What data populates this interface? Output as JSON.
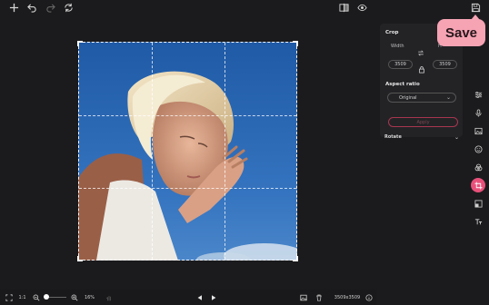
{
  "crop_panel": {
    "title": "Crop",
    "width_label": "Width",
    "height_label": "H",
    "width_value": "3509",
    "height_value": "3509",
    "aspect_ratio_label": "Aspect ratio",
    "aspect_ratio_value": "Original",
    "apply_label": "Apply"
  },
  "rotate": {
    "label": "Rotate"
  },
  "bottom_bar": {
    "ratio_label": "1:1",
    "zoom_value": "16%",
    "image_size": "3509x3509"
  },
  "tooltip": {
    "save_label": "Save"
  },
  "colors": {
    "accent": "#e8507a",
    "tooltip_bg": "#f6a3b4",
    "background": "#1b1b1d",
    "panel_card": "#232326"
  },
  "icons": {
    "top_left": [
      "plus-icon",
      "undo-icon",
      "redo-icon",
      "reset-icon"
    ],
    "top_right": [
      "compare-icon",
      "eye-icon",
      "save-icon"
    ],
    "tools": [
      "adjust-icon",
      "mic-icon",
      "image-icon",
      "face-icon",
      "filters-icon",
      "crop-icon",
      "resize-icon",
      "text-icon"
    ]
  }
}
